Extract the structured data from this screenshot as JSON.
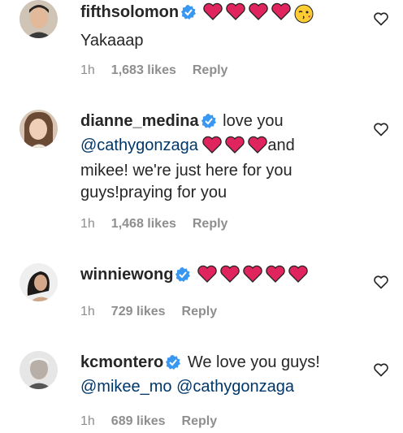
{
  "comments": [
    {
      "username": "fifthsolomon",
      "text_parts": [
        "Yakaaap"
      ],
      "time": "1h",
      "likes": "1,683 likes",
      "reply": "Reply"
    },
    {
      "username": "dianne_medina",
      "text_parts": [
        "love you",
        "@cathygonzaga",
        "and",
        "mikee! we're just here for you",
        "guys!praying for you"
      ],
      "time": "1h",
      "likes": "1,468 likes",
      "reply": "Reply"
    },
    {
      "username": "winniewong",
      "text_parts": [],
      "time": "1h",
      "likes": "729 likes",
      "reply": "Reply"
    },
    {
      "username": "kcmontero",
      "text_parts": [
        "We love you guys!",
        "@mikee_mo",
        "@cathygonzaga"
      ],
      "time": "1h",
      "likes": "689 likes",
      "reply": "Reply"
    }
  ],
  "colors": {
    "heart_red": "#e0245e",
    "verified_blue": "#3897f0",
    "mention": "#00376b",
    "meta_gray": "#8e8e8e"
  },
  "icons": [
    "verified-badge-icon",
    "red-heart-emoji-icon",
    "kissing-face-emoji-icon",
    "like-heart-outline-icon"
  ]
}
